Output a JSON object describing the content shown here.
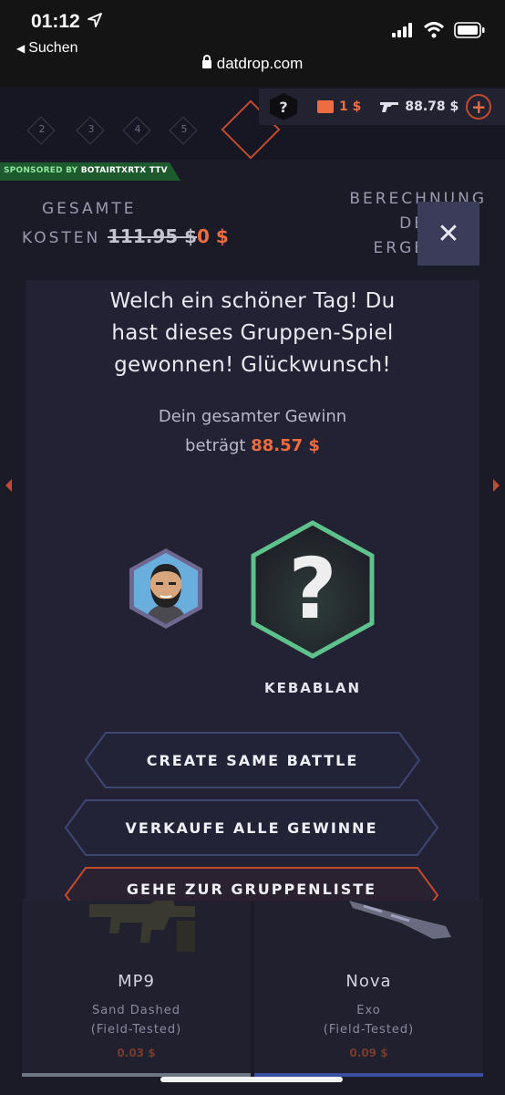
{
  "status_bar": {
    "time": "01:12",
    "back_label": "Suchen",
    "url": "datdrop.com"
  },
  "topbar": {
    "rounds": [
      "2",
      "3",
      "4",
      "5"
    ],
    "help_label": "?",
    "wallet_amount": "1 $",
    "inventory_amount": "88.78 $",
    "add_label": "+"
  },
  "sponsor": {
    "prefix": "SPONSORED BY",
    "name": "BOTAIRTXRTX TTV"
  },
  "cost": {
    "label_line1": "GESAMTE",
    "label_line2": "KOSTEN",
    "old_price": "111.95 $",
    "new_price": "0 $"
  },
  "calculation": {
    "line1": "BERECHNUNG",
    "line2": "DE",
    "line3": "ERGE"
  },
  "modal": {
    "close_label": "✕",
    "title_line1": "Welch ein schöner Tag! Du",
    "title_line2": "hast dieses Gruppen-Spiel",
    "title_line3": "gewonnen! Glückwunsch!",
    "sub_line1": "Dein gesamter Gewinn",
    "sub_line2": "beträgt",
    "amount": "88.57 $",
    "mystery_symbol": "?",
    "winner_name": "KEBABLAN",
    "buttons": [
      {
        "label": "CREATE SAME BATTLE"
      },
      {
        "label": "VERKAUFE ALLE GEWINNE"
      },
      {
        "label": "GEHE ZUR GRUPPENLISTE"
      }
    ]
  },
  "items": [
    {
      "name": "MP9",
      "skin": "Sand Dashed",
      "condition": "(Field-Tested)",
      "price": "0.03 $",
      "rarity_color": "#6f7683"
    },
    {
      "name": "Nova",
      "skin": "Exo",
      "condition": "(Field-Tested)",
      "price": "0.09 $",
      "rarity_color": "#3a4fa0"
    }
  ],
  "colors": {
    "accent": "#ee6c3f",
    "mystery_border": "#5dc28c",
    "sponsor_bg": "#1d5a2d"
  }
}
